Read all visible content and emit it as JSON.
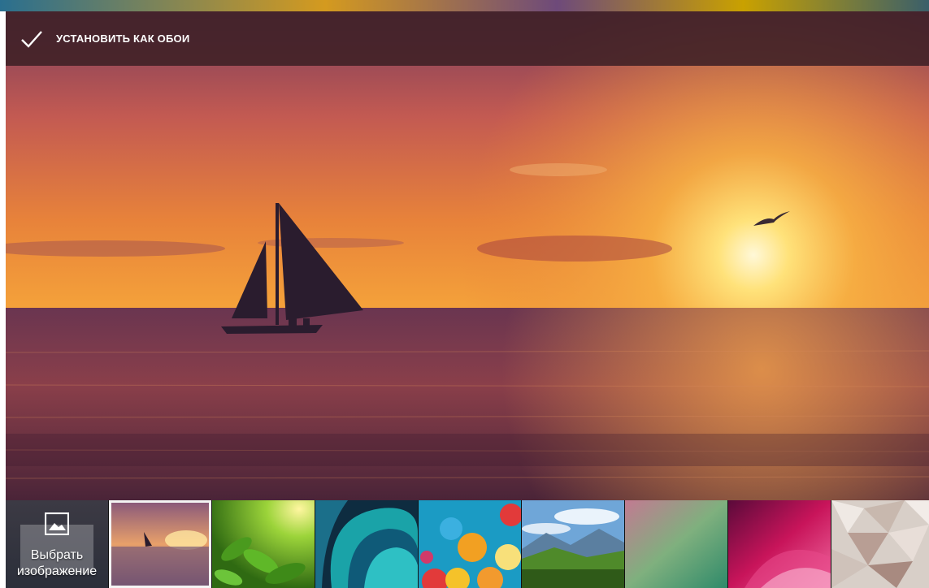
{
  "action_bar": {
    "set_wallpaper_label": "УСТАНОВИТЬ КАК ОБОИ",
    "icon": "checkmark-icon"
  },
  "preview": {
    "description_icon": "sunset-sailboat-wallpaper"
  },
  "thumbnails": {
    "pick_image": {
      "icon": "image-icon",
      "label_line1": "Выбрать",
      "label_line2": "изображение"
    },
    "items": [
      {
        "name": "sunset-sailboat",
        "selected": true
      },
      {
        "name": "green-leaves",
        "selected": false
      },
      {
        "name": "teal-abstract",
        "selected": false
      },
      {
        "name": "balloons",
        "selected": false
      },
      {
        "name": "mountains",
        "selected": false
      },
      {
        "name": "green-pink-gradient",
        "selected": false
      },
      {
        "name": "magenta-abstract",
        "selected": false
      },
      {
        "name": "polygon-pattern",
        "selected": false
      }
    ]
  },
  "colors": {
    "action_bar": "#3e2026",
    "selected_border": "#f4f4f4"
  }
}
